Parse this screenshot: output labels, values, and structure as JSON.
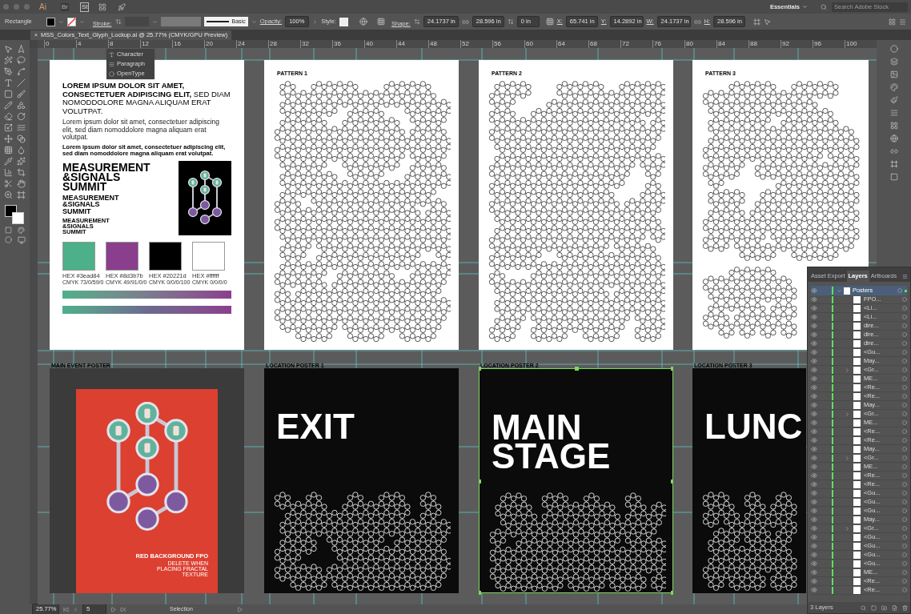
{
  "app_bar": {
    "app": "Ai",
    "bridge": "Br",
    "stock": "St",
    "workspace": "Essentials",
    "search": {
      "placeholder": "Search Adobe Stock"
    }
  },
  "control_bar": {
    "tool": "Rectangle",
    "stroke_label": "Stroke:",
    "stroke_style": "Basic",
    "opacity_label": "Opacity:",
    "opacity": "100%",
    "style_label": "Style:",
    "shape_label": "Shape:",
    "shape_width": "24.1737 in",
    "shape_height": "28.596 in",
    "corner": "0 in",
    "x_label": "X:",
    "x": "65.741 in",
    "y_label": "Y:",
    "y": "14.2892 in",
    "w_label": "W:",
    "w": "24.1737 in",
    "h_label": "H:",
    "h": "28.596 in"
  },
  "document_tab": {
    "close": "×",
    "title": "MSS_Colors_Text_Glyph_Lockup.ai @ 25.77% (CMYK/GPU Preview)"
  },
  "ruler_ticks": [
    "0",
    "4",
    "8",
    "12",
    "16",
    "20",
    "24",
    "28",
    "32",
    "36",
    "40",
    "44",
    "48",
    "52",
    "56",
    "60",
    "64",
    "68",
    "72",
    "76",
    "80",
    "84",
    "88",
    "92",
    "96",
    "100"
  ],
  "flyout_menu": [
    {
      "label": "Character"
    },
    {
      "label": "Paragraph"
    },
    {
      "label": "OpenType"
    }
  ],
  "style_sheet": {
    "headline": "**LOREM IPSUM DOLOR SIT AMET, CONSECTETUER ADIPISCING ELIT,** SED DIAM NOMODDOLORE MAGNA ALIQUAM ERAT VOLUTPAT.",
    "body": "Lorem ipsum dolor sit amet, consectetuer adipiscing elit, sed diam nomoddolore magna aliquam erat volutpat.",
    "caption": "Lorem ipsum dolor sit amet, consectetuer adipiscing elit, sed diam nomoddolore magna aliquam erat volutpat.",
    "lockups": [
      {
        "kind": "large",
        "text": "MEASUREMENT\n&SIGNALS\nSUMMIT"
      },
      {
        "kind": "medium",
        "text": "MEASUREMENT\n&SIGNALS\nSUMMIT"
      },
      {
        "kind": "small",
        "text": "MEASUREMENT\n&SIGNALS\nSUMMIT"
      }
    ],
    "swatches": [
      {
        "color": "#4cb08a",
        "hex": "HEX #3ead84",
        "cmyk": "CMYK 73/0/59/0"
      },
      {
        "color": "#8a3f8c",
        "hex": "HEX #8d3b7b",
        "cmyk": "CMYK 49/91/0/0"
      },
      {
        "color": "#000000",
        "hex": "HEX #20221d",
        "cmyk": "CMYK 0/0/0/100"
      },
      {
        "color": "#ffffff",
        "hex": "HEX #ffffff",
        "cmyk": "CMYK 0/0/0/0"
      }
    ]
  },
  "patterns": [
    {
      "label": "PATTERN 1"
    },
    {
      "label": "PATTERN 2"
    },
    {
      "label": "PATTERN 3"
    }
  ],
  "posters": [
    {
      "kind": "main",
      "label": "MAIN EVENT POSTER",
      "selected": false,
      "note_title": "RED BACKGROUND FPO",
      "note": "DELETE WHEN\nPLACING FRACTAL\nTEXTURE"
    },
    {
      "kind": "location",
      "label": "LOCATION POSTER 1",
      "selected": false,
      "headline": "EXIT"
    },
    {
      "kind": "location",
      "label": "LOCATION POSTER 2",
      "selected": true,
      "headline": "MAIN\nSTAGE"
    },
    {
      "kind": "location",
      "label": "LOCATION POSTER 3",
      "selected": false,
      "headline": "LUNC"
    }
  ],
  "layers_panel": {
    "tabs": [
      {
        "label": "Asset Export",
        "selected": false
      },
      {
        "label": "Layers",
        "selected": true
      },
      {
        "label": "Artboards",
        "selected": false
      }
    ],
    "root": {
      "name": "Posters",
      "expanded": true,
      "children": [
        {
          "name": "FPO...",
          "kind": "item"
        },
        {
          "name": "<Li...",
          "kind": "item"
        },
        {
          "name": "<Li...",
          "kind": "item"
        },
        {
          "name": "dire...",
          "kind": "item"
        },
        {
          "name": "dire...",
          "kind": "item"
        },
        {
          "name": "dire...",
          "kind": "item"
        },
        {
          "name": "<Gu...",
          "kind": "item"
        },
        {
          "name": "May...",
          "kind": "item"
        },
        {
          "name": "<Gr...",
          "kind": "group"
        },
        {
          "name": "ME...",
          "kind": "item"
        },
        {
          "name": "<Re...",
          "kind": "item"
        },
        {
          "name": "<Re...",
          "kind": "item"
        },
        {
          "name": "May...",
          "kind": "item"
        },
        {
          "name": "<Gr...",
          "kind": "group"
        },
        {
          "name": "ME...",
          "kind": "item"
        },
        {
          "name": "<Re...",
          "kind": "item"
        },
        {
          "name": "<Re...",
          "kind": "item"
        },
        {
          "name": "May...",
          "kind": "item"
        },
        {
          "name": "<Gr...",
          "kind": "group"
        },
        {
          "name": "ME...",
          "kind": "item"
        },
        {
          "name": "<Re...",
          "kind": "item"
        },
        {
          "name": "<Re...",
          "kind": "item"
        },
        {
          "name": "<Gu...",
          "kind": "item"
        },
        {
          "name": "<Gu...",
          "kind": "item"
        },
        {
          "name": "<Gu...",
          "kind": "item"
        },
        {
          "name": "May...",
          "kind": "item"
        },
        {
          "name": "<Gr...",
          "kind": "group"
        },
        {
          "name": "<Gu...",
          "kind": "item"
        },
        {
          "name": "<Gu...",
          "kind": "item"
        },
        {
          "name": "<Gu...",
          "kind": "item"
        },
        {
          "name": "<Gu...",
          "kind": "item"
        },
        {
          "name": "ME...",
          "kind": "item"
        },
        {
          "name": "<Re...",
          "kind": "item"
        },
        {
          "name": "<Re...",
          "kind": "item"
        }
      ]
    },
    "footer": "3 Layers"
  },
  "status_bar": {
    "zoom": "25.77%",
    "artboard": "5",
    "tool": "Selection"
  }
}
